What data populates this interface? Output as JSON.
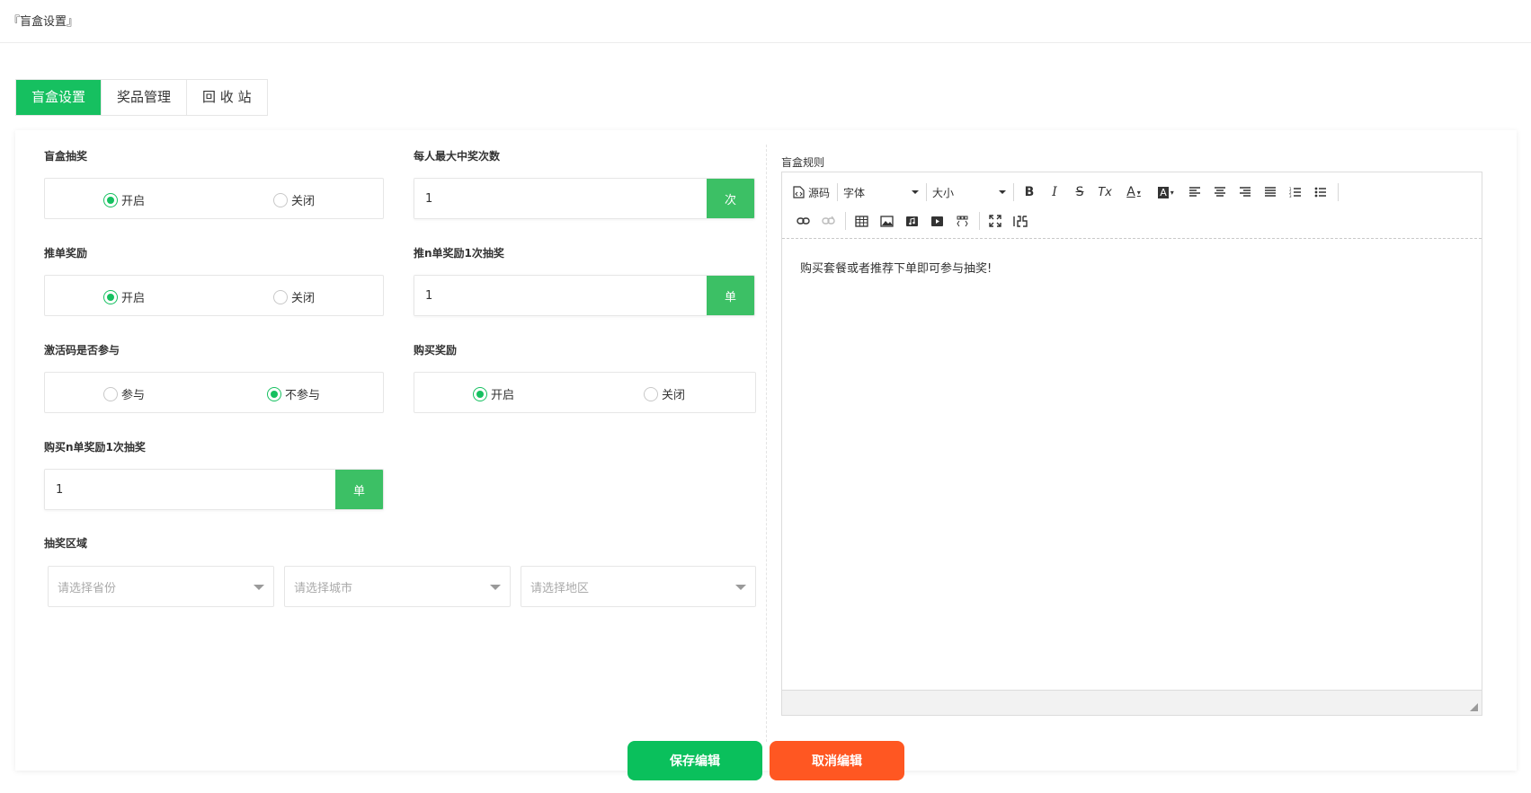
{
  "page_title": "『盲盒设置』",
  "tabs": [
    {
      "label": "盲盒设置",
      "active": true
    },
    {
      "label": "奖品管理",
      "active": false
    },
    {
      "label": "回 收 站",
      "active": false
    }
  ],
  "form": {
    "lottery": {
      "label": "盲盒抽奖",
      "options": [
        "开启",
        "关闭"
      ],
      "selected": "开启"
    },
    "max_wins": {
      "label": "每人最大中奖次数",
      "value": "1",
      "unit": "次"
    },
    "referral_reward": {
      "label": "推单奖励",
      "options": [
        "开启",
        "关闭"
      ],
      "selected": "开启"
    },
    "referral_n": {
      "label": "推n单奖励1次抽奖",
      "value": "1",
      "unit": "单"
    },
    "activation_code": {
      "label": "激活码是否参与",
      "options": [
        "参与",
        "不参与"
      ],
      "selected": "不参与"
    },
    "purchase_reward": {
      "label": "购买奖励",
      "options": [
        "开启",
        "关闭"
      ],
      "selected": "开启"
    },
    "purchase_n": {
      "label": "购买n单奖励1次抽奖",
      "value": "1",
      "unit": "单"
    },
    "region": {
      "label": "抽奖区域",
      "province_placeholder": "请选择省份",
      "city_placeholder": "请选择城市",
      "district_placeholder": "请选择地区"
    }
  },
  "editor": {
    "label": "盲盒规则",
    "toolbar": {
      "source_label": "源码",
      "font_label": "字体",
      "size_label": "大小",
      "bold": "B",
      "italic": "I",
      "strike": "S",
      "clear_format": "Tx",
      "font_color": "A",
      "bg_color": "A"
    },
    "content": "购买套餐或者推荐下单即可参与抽奖!"
  },
  "actions": {
    "save_label": "保存编辑",
    "cancel_label": "取消编辑"
  },
  "colors": {
    "accent": "#16c060",
    "addon": "#3cc065",
    "danger": "#ff5722"
  }
}
